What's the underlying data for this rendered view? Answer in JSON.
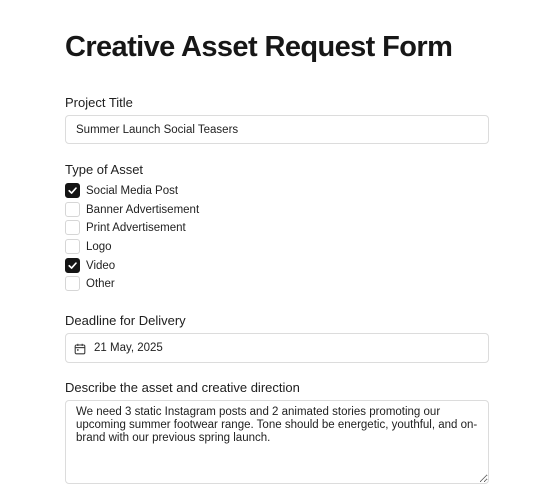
{
  "form": {
    "title": "Creative Asset Request Form",
    "project_title": {
      "label": "Project Title",
      "value": "Summer Launch Social Teasers"
    },
    "asset_type": {
      "label": "Type of Asset",
      "options": [
        {
          "label": "Social Media Post",
          "checked": true
        },
        {
          "label": "Banner Advertisement",
          "checked": false
        },
        {
          "label": "Print Advertisement",
          "checked": false
        },
        {
          "label": "Logo",
          "checked": false
        },
        {
          "label": "Video",
          "checked": true
        },
        {
          "label": "Other",
          "checked": false
        }
      ]
    },
    "deadline": {
      "label": "Deadline for Delivery",
      "value": "21 May, 2025",
      "icon": "calendar-icon"
    },
    "description": {
      "label": "Describe the asset and creative direction",
      "value": "We need 3 static Instagram posts and 2 animated stories promoting our upcoming summer footwear range. Tone should be energetic, youthful, and on-brand with our previous spring launch."
    }
  },
  "colors": {
    "checked_fill": "#141414",
    "border": "#dcdcdc",
    "text": "#222222"
  }
}
